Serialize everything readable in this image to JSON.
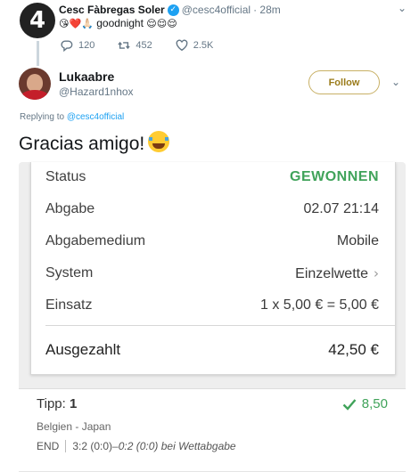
{
  "parent_tweet": {
    "avatar_text": "4",
    "name": "Cesc Fàbregas Soler",
    "verified_symbol": "✓",
    "handle": "@cesc4official",
    "time": "· 28m",
    "emoji_prefix": "😘❤️🙏🏻",
    "text": "goodnight",
    "emoji_suffix": "😌😌😌",
    "replies": "120",
    "retweets": "452",
    "likes": "2.5K"
  },
  "reply": {
    "name": "Lukaabre",
    "handle": "@Hazard1nhox",
    "follow_label": "Follow",
    "replying_prefix": "Replying to",
    "replying_handle": "@cesc4official",
    "text": "Gracias amigo!",
    "emoji": "crying-laughing"
  },
  "bet_slip": {
    "rows": [
      {
        "label": "Status",
        "value": "GEWONNEN"
      },
      {
        "label": "Abgabe",
        "value": "02.07 21:14"
      },
      {
        "label": "Abgabemedium",
        "value": "Mobile"
      },
      {
        "label": "System",
        "value": "Einzelwette"
      },
      {
        "label": "Einsatz",
        "value": "1 x 5,00 € = 5,00 €"
      }
    ],
    "total_label": "Ausgezahlt",
    "total_value": "42,50 €",
    "tip_label": "Tipp:",
    "tip_number": "1",
    "odds": "8,50",
    "match": "Belgien - Japan",
    "status_short": "END",
    "score_final": "3:2 (0:0)",
    "score_at_bet": "–0:2 (0:0) bei Wettabgabe"
  },
  "colors": {
    "twitter_blue": "#1da1f2",
    "win_green": "#40a35a",
    "follow_border": "#c8b065"
  }
}
